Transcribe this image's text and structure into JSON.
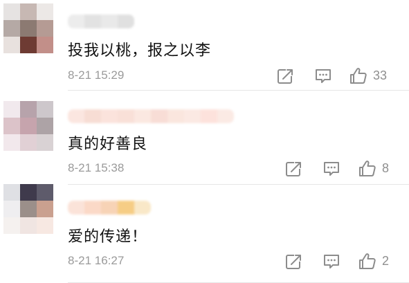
{
  "comments": [
    {
      "text": "投我以桃，报之以李",
      "time": "8-21 15:29",
      "likes": "33",
      "avatar_colors": [
        "#e6e3e2",
        "#c7b8b3",
        "#ece8e6",
        "#b5a9a5",
        "#8c7a72",
        "#b59b94",
        "#e8e1de",
        "#6e3b33",
        "#c28f89"
      ],
      "username_colors": [
        "#ececec",
        "#e2e2e2",
        "#e9e9e9",
        "#e0e0e0"
      ]
    },
    {
      "text": "真的好善良",
      "time": "8-21 15:38",
      "likes": "8",
      "avatar_colors": [
        "#f1e9ed",
        "#b7a3ab",
        "#cdc7cb",
        "#dcc3c9",
        "#c6a4ad",
        "#ada3a6",
        "#f2e8ec",
        "#e1d0d5",
        "#d9d2d4"
      ],
      "username_colors": [
        "#fbe6e0",
        "#f7ddd4",
        "#fbe3dc",
        "#f9e0d8",
        "#fbe8e1",
        "#f8ddd6",
        "#fae6de",
        "#fbe9e3",
        "#fde2dc",
        "#fbeae4"
      ]
    },
    {
      "text": "爱的传递！",
      "time": "8-21 16:27",
      "likes": "2",
      "avatar_colors": [
        "#dfe0e4",
        "#3f3a4c",
        "#5e5b6b",
        "#efeef0",
        "#9b8f8a",
        "#caa08f",
        "#f5f1ef",
        "#f0e5e2",
        "#f7e8e2"
      ],
      "username_colors": [
        "#fbe3d9",
        "#fbd9c7",
        "#f7d3b6",
        "#f6cd85",
        "#f9e8c8"
      ]
    }
  ],
  "icons": {
    "repost": "repost-icon",
    "comment": "comment-icon",
    "like": "thumbs-up-icon"
  },
  "colors": {
    "text": "#111111",
    "meta": "#9a9a9a",
    "icon": "#8c8c8c",
    "divider": "#e6e6e6"
  }
}
